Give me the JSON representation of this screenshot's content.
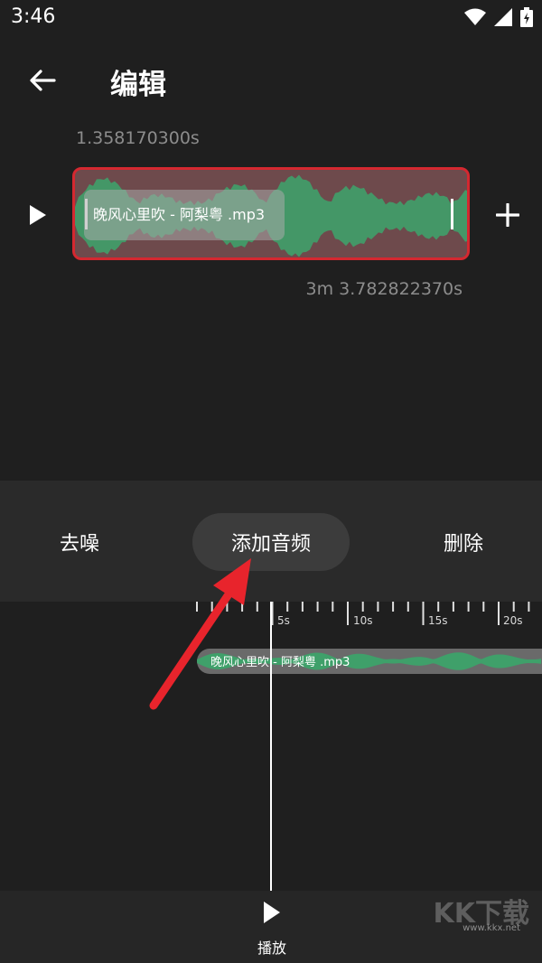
{
  "status_bar": {
    "time": "3:46",
    "icons": [
      "wifi-icon",
      "signal-icon",
      "battery-charging-icon"
    ]
  },
  "header": {
    "title": "编辑",
    "back_icon": "arrow-left-icon"
  },
  "editor": {
    "start_time": "1.358170300s",
    "end_time": "3m 3.782822370s",
    "clip_name": "晚风心里吹 - 阿梨粤 .mp3",
    "play_icon": "play-icon",
    "add_icon": "plus-icon"
  },
  "actions": {
    "denoise": "去噪",
    "add_audio": "添加音频",
    "delete": "删除"
  },
  "timeline": {
    "ticks": [
      "5s",
      "10s",
      "15s",
      "20s"
    ],
    "track_name": "晚风心里吹 - 阿梨粤 .mp3"
  },
  "bottom": {
    "play_label": "播放",
    "play_icon": "play-icon"
  },
  "watermark": {
    "logo": "KK下载",
    "url": "www.kkx.net"
  },
  "colors": {
    "background": "#1f1f1f",
    "wave_green": "#3fa06a",
    "selection_red": "#d42830",
    "clip_fill": "#6e4a4c"
  }
}
